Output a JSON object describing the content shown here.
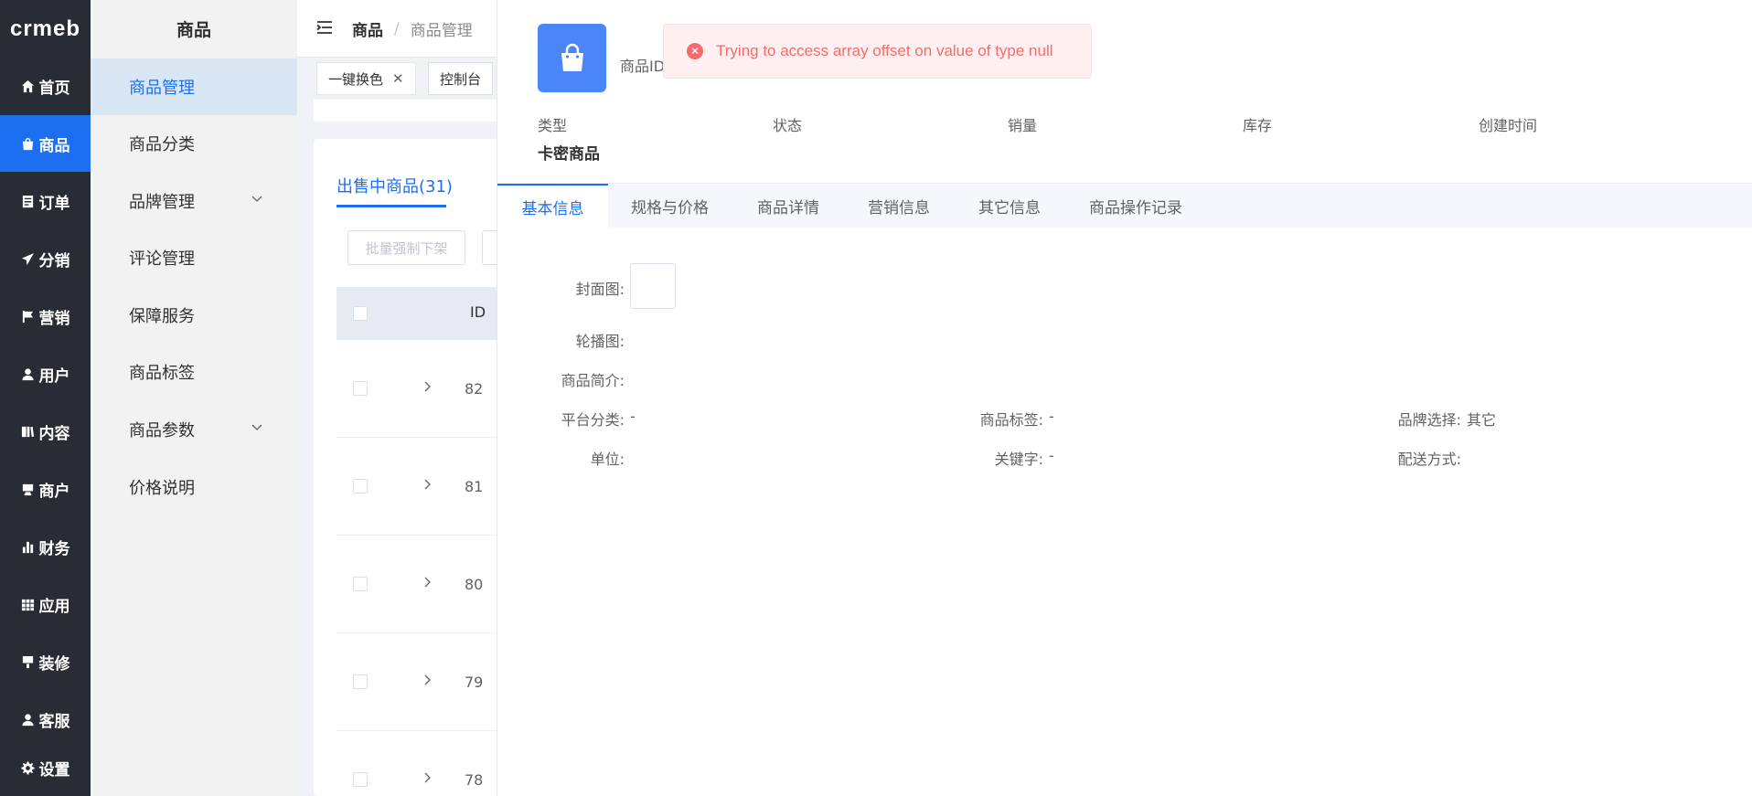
{
  "brand": {
    "logo_text": "crmeb"
  },
  "rail": {
    "items": [
      {
        "label": "首页",
        "icon": "home-icon"
      },
      {
        "label": "商品",
        "icon": "bag-icon",
        "active": true
      },
      {
        "label": "订单",
        "icon": "order-icon"
      },
      {
        "label": "分销",
        "icon": "send-icon"
      },
      {
        "label": "营销",
        "icon": "flag-icon"
      },
      {
        "label": "用户",
        "icon": "user-icon"
      },
      {
        "label": "内容",
        "icon": "book-icon"
      },
      {
        "label": "商户",
        "icon": "store-icon"
      },
      {
        "label": "财务",
        "icon": "bar-chart-icon"
      },
      {
        "label": "应用",
        "icon": "grid-icon"
      },
      {
        "label": "装修",
        "icon": "brush-icon"
      },
      {
        "label": "客服",
        "icon": "service-icon"
      },
      {
        "label": "设置",
        "icon": "gear-icon"
      }
    ]
  },
  "subnav": {
    "title": "商品",
    "items": [
      {
        "label": "商品管理",
        "active": true
      },
      {
        "label": "商品分类"
      },
      {
        "label": "品牌管理",
        "expandable": true
      },
      {
        "label": "评论管理"
      },
      {
        "label": "保障服务"
      },
      {
        "label": "商品标签"
      },
      {
        "label": "商品参数",
        "expandable": true
      },
      {
        "label": "价格说明"
      }
    ]
  },
  "header": {
    "breadcrumb": [
      "商品",
      "商品管理"
    ],
    "separator": "/"
  },
  "tags": [
    {
      "label": "一键换色",
      "closable": true
    },
    {
      "label": "控制台"
    }
  ],
  "list": {
    "tab_label": "出售中商品(31)",
    "batch_button": "批量强制下架",
    "id_header": "ID",
    "row_ids": [
      "82",
      "81",
      "80",
      "79",
      "78"
    ]
  },
  "drawer": {
    "product_id_label": "商品ID",
    "meta": {
      "labels": [
        "类型",
        "状态",
        "销量",
        "库存",
        "创建时间"
      ],
      "type_value": "卡密商品"
    },
    "tabs": [
      "基本信息",
      "规格与价格",
      "商品详情",
      "营销信息",
      "其它信息",
      "商品操作记录"
    ],
    "fields": {
      "cover": "封面图:",
      "carousel": "轮播图:",
      "intro": "商品简介:",
      "platform_category": "平台分类:",
      "platform_category_value": "-",
      "product_tags": "商品标签:",
      "product_tags_value": "-",
      "brand": "品牌选择:",
      "brand_value": "其它",
      "unit": "单位:",
      "keywords": "关键字:",
      "keywords_value": "-",
      "delivery": "配送方式:"
    }
  },
  "toast": {
    "message": "Trying to access array offset on value of type null",
    "icon": "error-icon"
  },
  "colors": {
    "primary": "#1d6ff2",
    "rail_bg": "#282c34",
    "error": "#f56c6c"
  }
}
